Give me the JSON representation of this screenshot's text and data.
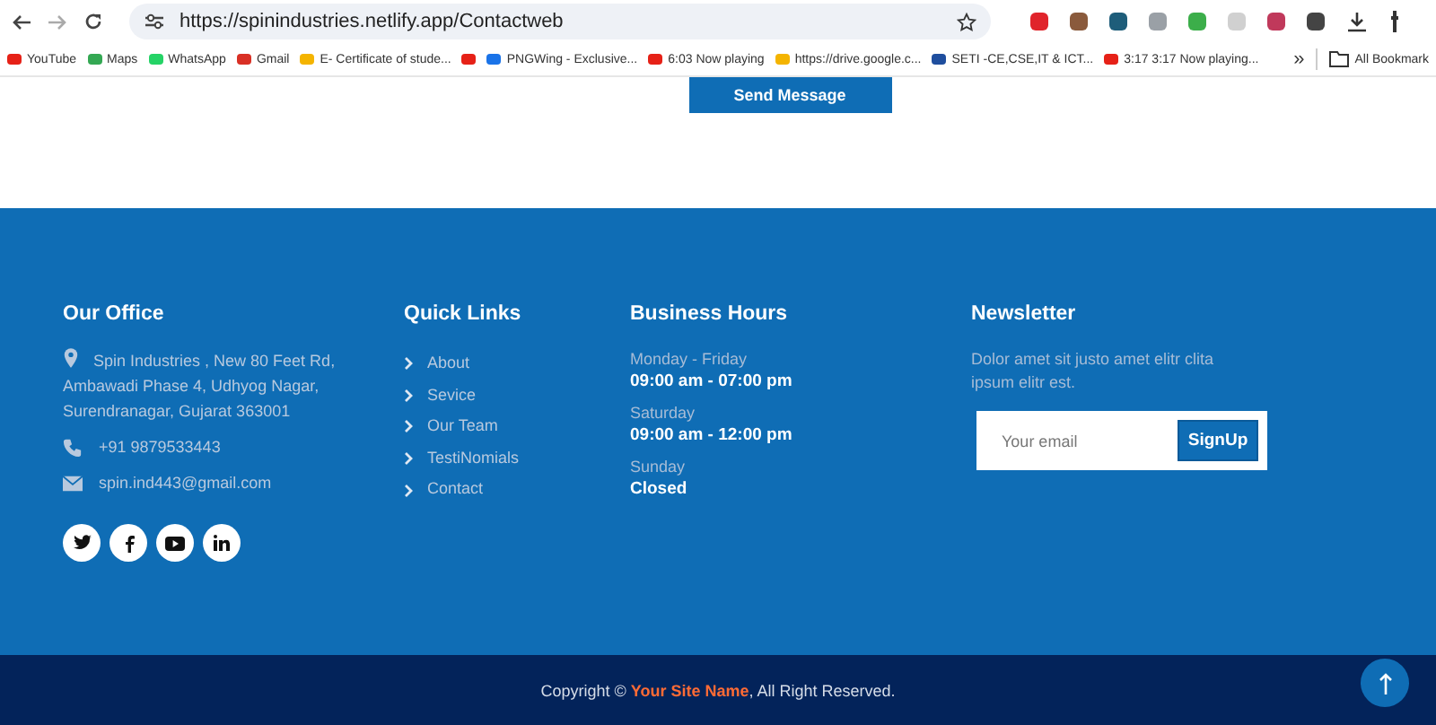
{
  "browser": {
    "url": "https://spinindustries.netlify.app/Contactweb",
    "bookmarks": [
      {
        "label": "YouTube",
        "kind": "youtube"
      },
      {
        "label": "Maps",
        "kind": "maps"
      },
      {
        "label": "WhatsApp",
        "kind": "whatsapp"
      },
      {
        "label": "Gmail",
        "kind": "gmail"
      },
      {
        "label": "E- Certificate of stude...",
        "kind": "drive"
      },
      {
        "kind": "youtube"
      },
      {
        "label": "PNGWing - Exclusive...",
        "kind": "pngwing"
      },
      {
        "label": "6:03 Now playing",
        "kind": "youtube"
      },
      {
        "label": "https://drive.google.c...",
        "kind": "drive"
      },
      {
        "label": "SETI -CE,CSE,IT & ICT...",
        "kind": "seti"
      },
      {
        "label": "3:17 3:17 Now playing...",
        "kind": "youtube"
      }
    ],
    "more": "»",
    "all_bookmarks": "All Bookmark"
  },
  "send_button": "Send Message",
  "footer": {
    "office": {
      "title": "Our Office",
      "address": "Spin Industries , New 80 Feet Rd, Ambawadi Phase 4, Udhyog Nagar, Surendranagar, Gujarat 363001",
      "phone": "+91 9879533443",
      "email": "spin.ind443@gmail.com",
      "socials": [
        {
          "kind": "twitter"
        },
        {
          "kind": "facebook"
        },
        {
          "kind": "youtube"
        },
        {
          "kind": "linkedin"
        }
      ]
    },
    "links": {
      "title": "Quick Links",
      "items": [
        "About",
        "Sevice",
        "Our Team",
        "TestiNomials",
        "Contact"
      ]
    },
    "hours": {
      "title": "Business Hours",
      "rows": [
        {
          "day": "Monday - Friday",
          "time": "09:00 am - 07:00 pm"
        },
        {
          "day": "Saturday",
          "time": "09:00 am - 12:00 pm"
        },
        {
          "day": "Sunday",
          "time": "Closed"
        }
      ]
    },
    "newsletter": {
      "title": "Newsletter",
      "text": "Dolor amet sit justo amet elitr clita ipsum elitr est.",
      "placeholder": "Your email",
      "button": "SignUp"
    }
  },
  "copyright": {
    "before": "Copyright ©",
    "site": "Your Site Name",
    "after": ", All Right Reserved."
  }
}
